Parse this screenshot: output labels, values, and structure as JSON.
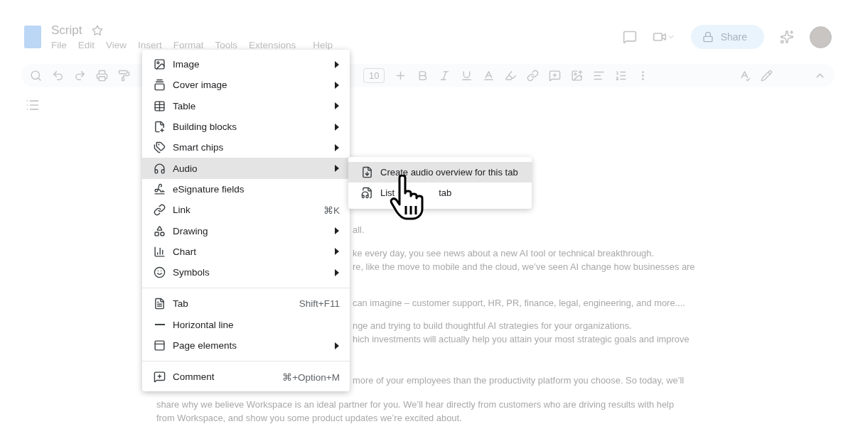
{
  "doc": {
    "title": "Script",
    "starred": false
  },
  "menubar": [
    {
      "label": "File"
    },
    {
      "label": "Edit"
    },
    {
      "label": "View"
    },
    {
      "label": "Insert"
    },
    {
      "label": "Format"
    },
    {
      "label": "Tools"
    },
    {
      "label": "Extensions"
    },
    {
      "label": "Help"
    }
  ],
  "share": {
    "label": "Share"
  },
  "toolbar": {
    "font_size": "10"
  },
  "body_paragraphs": [
    [
      "all."
    ],
    [
      "ke every day, you see news about a new AI tool or technical breakthrough.",
      "re, like the move to mobile and the cloud, we’ve seen AI change how businesses are"
    ],
    [
      "can imagine – customer support, HR, PR, finance, legal, engineering, and more...."
    ],
    [
      "nge and trying to build thoughtful AI strategies for your organizations.",
      "hich investments will actually help you attain your most strategic goals and improve"
    ],
    [
      "more of your employees than the productivity platform you choose. So today, we’ll"
    ]
  ],
  "body_full_lines": [
    "share why we believe Workspace is an ideal partner for you. We’ll hear directly from customers who are driving results with help",
    "from Workspace, and show you some product updates we’re excited about."
  ],
  "insert_menu": {
    "groups": [
      [
        {
          "label": "Image",
          "submenu": true,
          "selected": false
        },
        {
          "label": "Cover image",
          "submenu": true,
          "selected": false
        },
        {
          "label": "Table",
          "submenu": true,
          "selected": false
        },
        {
          "label": "Building blocks",
          "submenu": true,
          "selected": false
        },
        {
          "label": "Smart chips",
          "submenu": true,
          "selected": false
        },
        {
          "label": "Audio",
          "submenu": true,
          "selected": true
        },
        {
          "label": "eSignature fields",
          "submenu": false,
          "selected": false
        },
        {
          "label": "Link",
          "submenu": false,
          "shortcut": "⌘K",
          "selected": false
        },
        {
          "label": "Drawing",
          "submenu": true,
          "selected": false
        },
        {
          "label": "Chart",
          "submenu": true,
          "selected": false
        },
        {
          "label": "Symbols",
          "submenu": true,
          "selected": false
        }
      ],
      [
        {
          "label": "Tab",
          "submenu": false,
          "shortcut": "Shift+F11",
          "selected": false
        },
        {
          "label": "Horizontal line",
          "submenu": false,
          "selected": false
        },
        {
          "label": "Page elements",
          "submenu": true,
          "selected": false
        }
      ],
      [
        {
          "label": "Comment",
          "submenu": false,
          "shortcut": "⌘+Option+M",
          "selected": false
        }
      ]
    ]
  },
  "audio_submenu": [
    {
      "label_parts": [
        "Create audio overview for this tab"
      ],
      "selected": true
    },
    {
      "label_parts": [
        "List",
        "tab"
      ],
      "selected": false
    }
  ]
}
